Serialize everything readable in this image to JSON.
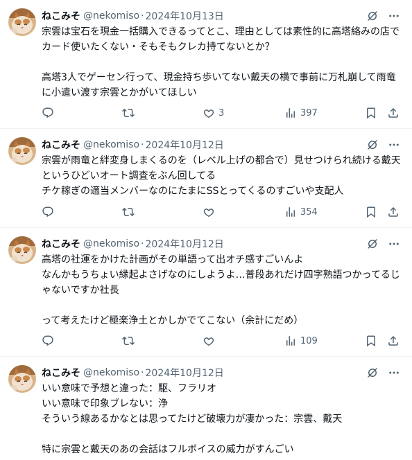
{
  "tweets": [
    {
      "name": "ねこみそ",
      "handle": "@nekomiso",
      "dot": "·",
      "date": "2024年10月13日",
      "text": "宗雲は宝石を現金一括購入できるってとこ、理由としては素性的に高塔絡みの店で\nカード使いたくない・そもそもクレカ持てないとか？\n\n高塔3人でゲーセン行って、現金持ち歩いてない戴天の横で事前に万札崩して雨竜\nに小遣い渡す宗雲とかがいてほしい",
      "reply_count": "",
      "retweet_count": "",
      "like_count": "3",
      "view_count": "397"
    },
    {
      "name": "ねこみそ",
      "handle": "@nekomiso",
      "dot": "·",
      "date": "2024年10月12日",
      "text": "宗雲が雨竜と絆変身しまくるのを（レベル上げの都合で）見せつけられ続ける戴天\nというひどいオート調査をぶん回してる\nチケ稼ぎの適当メンバーなのにたまにSSとってくるのすごいや支配人",
      "reply_count": "",
      "retweet_count": "",
      "like_count": "",
      "view_count": "354"
    },
    {
      "name": "ねこみそ",
      "handle": "@nekomiso",
      "dot": "·",
      "date": "2024年10月12日",
      "text": "高塔の社運をかけた計画がその単語って出オチ感すごいんよ\nなんかもうちょい縁起よさげなのにしようよ…普段あれだけ四字熟語つかってるじ\nゃないですか社長\n\nって考えたけど極楽浄土とかしかでてこない（余計にだめ）",
      "reply_count": "",
      "retweet_count": "",
      "like_count": "",
      "view_count": "109"
    },
    {
      "name": "ねこみそ",
      "handle": "@nekomiso",
      "dot": "·",
      "date": "2024年10月12日",
      "text": "いい意味で予想と違った：駆、フラリオ\nいい意味で印象ブレない：浄\nそういう線あるかなとは思ってたけど破壊力が凄かった：宗雲、戴天\n\n特に宗雲と戴天のあの会話はフルボイスの威力がすんごい",
      "reply_count": "",
      "retweet_count": "",
      "like_count": "",
      "view_count": ""
    }
  ],
  "colors": {
    "text": "#0f1419",
    "muted": "#536471",
    "border": "#eff3f4"
  }
}
